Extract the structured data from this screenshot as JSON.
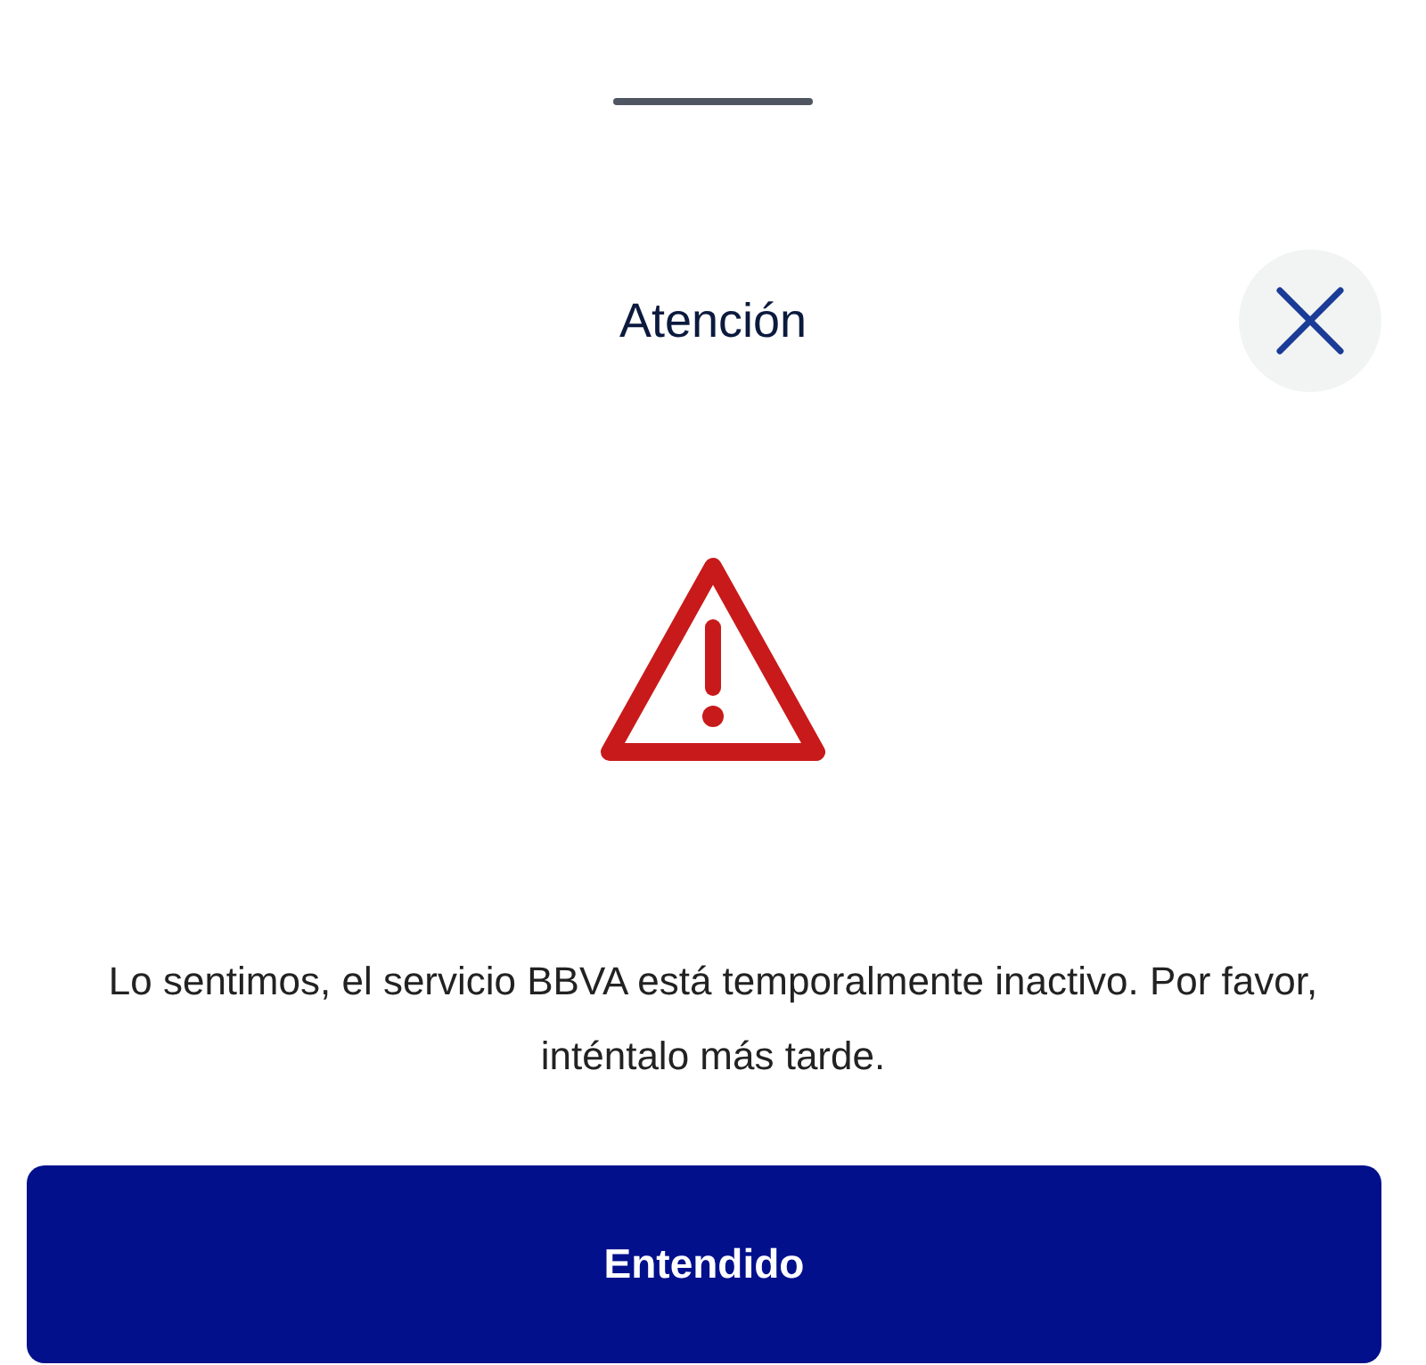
{
  "sheet": {
    "title": "Atención",
    "message": "Lo sentimos, el servicio BBVA está temporalmente inactivo. Por favor, inténtalo más tarde.",
    "button": "Entendido"
  }
}
